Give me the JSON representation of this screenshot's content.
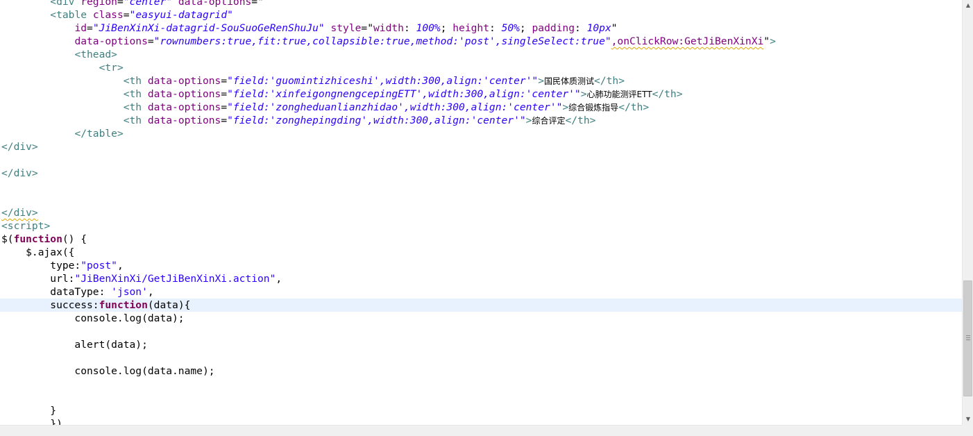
{
  "editor": {
    "lines": [
      {
        "tokens": [
          {
            "t": "        ",
            "c": "plain"
          },
          {
            "t": "<div ",
            "c": "tag"
          },
          {
            "t": "region",
            "c": "attr"
          },
          {
            "t": "=",
            "c": "plain"
          },
          {
            "t": "\"center\"",
            "c": "str"
          },
          {
            "t": " ",
            "c": "plain"
          },
          {
            "t": "data-options",
            "c": "attr"
          },
          {
            "t": "=",
            "c": "plain"
          },
          {
            "t": "\"",
            "c": "plain"
          }
        ]
      },
      {
        "tokens": [
          {
            "t": "        ",
            "c": "plain"
          },
          {
            "t": "<table ",
            "c": "tag"
          },
          {
            "t": "class",
            "c": "attr"
          },
          {
            "t": "=",
            "c": "plain"
          },
          {
            "t": "\"easyui-datagrid\"",
            "c": "str"
          }
        ]
      },
      {
        "tokens": [
          {
            "t": "            ",
            "c": "plain"
          },
          {
            "t": "id",
            "c": "attr"
          },
          {
            "t": "=",
            "c": "plain"
          },
          {
            "t": "\"JiBenXinXi-datagrid-SouSuoGeRenShuJu\"",
            "c": "str"
          },
          {
            "t": " ",
            "c": "plain"
          },
          {
            "t": "style",
            "c": "attr"
          },
          {
            "t": "=",
            "c": "plain"
          },
          {
            "t": "\"",
            "c": "plain"
          },
          {
            "t": "width",
            "c": "attr"
          },
          {
            "t": ": ",
            "c": "plain"
          },
          {
            "t": "100%",
            "c": "str"
          },
          {
            "t": "; ",
            "c": "plain"
          },
          {
            "t": "height",
            "c": "attr"
          },
          {
            "t": ": ",
            "c": "plain"
          },
          {
            "t": "50%",
            "c": "str"
          },
          {
            "t": "; ",
            "c": "plain"
          },
          {
            "t": "padding",
            "c": "attr"
          },
          {
            "t": ": ",
            "c": "plain"
          },
          {
            "t": "10px",
            "c": "str"
          },
          {
            "t": "\"",
            "c": "plain"
          }
        ]
      },
      {
        "tokens": [
          {
            "t": "            ",
            "c": "plain"
          },
          {
            "t": "data-options",
            "c": "attr"
          },
          {
            "t": "=",
            "c": "plain"
          },
          {
            "t": "\"rownumbers:true,fit:true,collapsible:true,method:'post',singleSelect:true\"",
            "c": "str"
          },
          {
            "t": ",onClickRow:GetJiBenXinXi",
            "c": "attr",
            "squig": true
          },
          {
            "t": "\"",
            "c": "plain"
          },
          {
            "t": ">",
            "c": "tag"
          }
        ]
      },
      {
        "tokens": [
          {
            "t": "            ",
            "c": "plain"
          },
          {
            "t": "<thead>",
            "c": "tag"
          }
        ]
      },
      {
        "tokens": [
          {
            "t": "                ",
            "c": "plain"
          },
          {
            "t": "<tr>",
            "c": "tag"
          }
        ]
      },
      {
        "tokens": [
          {
            "t": "                    ",
            "c": "plain"
          },
          {
            "t": "<th ",
            "c": "tag"
          },
          {
            "t": "data-options",
            "c": "attr"
          },
          {
            "t": "=",
            "c": "plain"
          },
          {
            "t": "\"field:'guomintizhiceshi',width:300,align:'center'\"",
            "c": "str"
          },
          {
            "t": ">",
            "c": "tag"
          },
          {
            "t": "国民体质测试",
            "c": "plain",
            "cjk": true
          },
          {
            "t": "</th>",
            "c": "tag"
          }
        ]
      },
      {
        "tokens": [
          {
            "t": "                    ",
            "c": "plain"
          },
          {
            "t": "<th ",
            "c": "tag"
          },
          {
            "t": "data-options",
            "c": "attr"
          },
          {
            "t": "=",
            "c": "plain"
          },
          {
            "t": "\"field:'xinfeigongnengcepingETT',width:300,align:'center'\"",
            "c": "str"
          },
          {
            "t": ">",
            "c": "tag"
          },
          {
            "t": "心肺功能测评ETT",
            "c": "plain",
            "cjk": true
          },
          {
            "t": "</th>",
            "c": "tag"
          }
        ]
      },
      {
        "tokens": [
          {
            "t": "                    ",
            "c": "plain"
          },
          {
            "t": "<th ",
            "c": "tag"
          },
          {
            "t": "data-options",
            "c": "attr"
          },
          {
            "t": "=",
            "c": "plain"
          },
          {
            "t": "\"field:'zongheduanlianzhidao',width:300,align:'center'\"",
            "c": "str"
          },
          {
            "t": ">",
            "c": "tag"
          },
          {
            "t": "综合锻炼指导",
            "c": "plain",
            "cjk": true
          },
          {
            "t": "</th>",
            "c": "tag"
          }
        ]
      },
      {
        "tokens": [
          {
            "t": "                    ",
            "c": "plain"
          },
          {
            "t": "<th ",
            "c": "tag"
          },
          {
            "t": "data-options",
            "c": "attr"
          },
          {
            "t": "=",
            "c": "plain"
          },
          {
            "t": "\"field:'zonghepingding',width:300,align:'center'\"",
            "c": "str"
          },
          {
            "t": ">",
            "c": "tag"
          },
          {
            "t": "综合评定",
            "c": "plain",
            "cjk": true
          },
          {
            "t": "</th>",
            "c": "tag"
          }
        ]
      },
      {
        "tokens": [
          {
            "t": "            ",
            "c": "plain"
          },
          {
            "t": "</table>",
            "c": "tag"
          }
        ]
      },
      {
        "tokens": [
          {
            "t": "</div>",
            "c": "tag"
          }
        ]
      },
      {
        "tokens": []
      },
      {
        "tokens": [
          {
            "t": "</div>",
            "c": "tag"
          }
        ]
      },
      {
        "tokens": []
      },
      {
        "tokens": []
      },
      {
        "tokens": [
          {
            "t": "</div>",
            "c": "tag",
            "squig": true
          }
        ]
      },
      {
        "tokens": [
          {
            "t": "<script>",
            "c": "tag"
          }
        ]
      },
      {
        "tokens": [
          {
            "t": "$(",
            "c": "plain"
          },
          {
            "t": "function",
            "c": "kw"
          },
          {
            "t": "() {",
            "c": "plain"
          }
        ]
      },
      {
        "tokens": [
          {
            "t": "    $.ajax({",
            "c": "plain"
          }
        ]
      },
      {
        "tokens": [
          {
            "t": "        type:",
            "c": "plain"
          },
          {
            "t": "\"post\"",
            "c": "jstr"
          },
          {
            "t": ",",
            "c": "plain"
          }
        ]
      },
      {
        "tokens": [
          {
            "t": "        url:",
            "c": "plain"
          },
          {
            "t": "\"JiBenXinXi/GetJiBenXinXi.action\"",
            "c": "jstr"
          },
          {
            "t": ",",
            "c": "plain"
          }
        ]
      },
      {
        "tokens": [
          {
            "t": "        dataType: ",
            "c": "plain"
          },
          {
            "t": "'json'",
            "c": "jstr"
          },
          {
            "t": ",",
            "c": "plain"
          }
        ]
      },
      {
        "current": true,
        "tokens": [
          {
            "t": "        success:",
            "c": "plain"
          },
          {
            "t": "function",
            "c": "kw"
          },
          {
            "t": "(data){",
            "c": "plain"
          }
        ]
      },
      {
        "tokens": [
          {
            "t": "            console.log(data);",
            "c": "plain"
          }
        ]
      },
      {
        "tokens": []
      },
      {
        "tokens": [
          {
            "t": "            alert(data);",
            "c": "plain"
          }
        ]
      },
      {
        "tokens": []
      },
      {
        "tokens": [
          {
            "t": "            console.log(data.name);",
            "c": "plain"
          }
        ]
      },
      {
        "tokens": []
      },
      {
        "tokens": []
      },
      {
        "tokens": [
          {
            "t": "        }",
            "c": "plain"
          }
        ]
      },
      {
        "tokens": [
          {
            "t": "        })",
            "c": "plain"
          }
        ]
      }
    ]
  },
  "scrollbar": {
    "up_arrow": "▲",
    "down_arrow": "▼",
    "position_fraction": 0.66
  }
}
